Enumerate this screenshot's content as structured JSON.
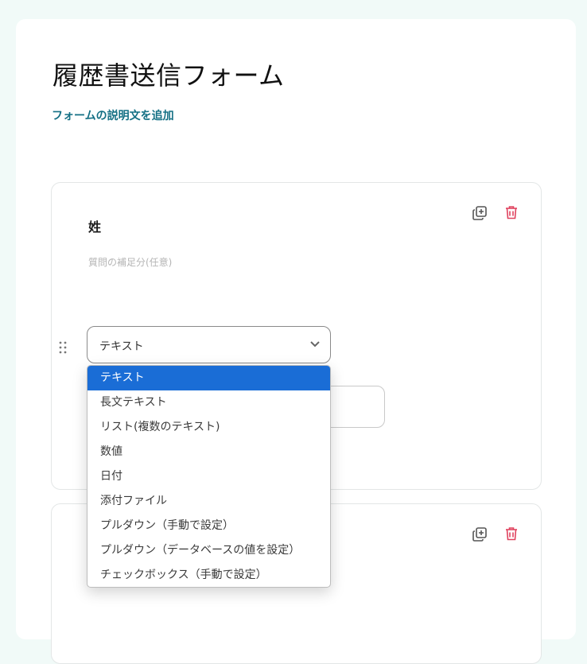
{
  "form": {
    "title": "履歴書送信フォーム",
    "add_description_link": "フォームの説明文を追加"
  },
  "question": {
    "title": "姓",
    "description_placeholder": "質問の補足分(任意)",
    "field_type_value": "テキスト"
  },
  "dropdown": {
    "options": [
      "テキスト",
      "長文テキスト",
      "リスト(複数のテキスト)",
      "数値",
      "日付",
      "添付ファイル",
      "プルダウン（手動で設定）",
      "プルダウン（データベースの値を設定）",
      "チェックボックス（手動で設定）"
    ],
    "selected_index": 0
  },
  "colors": {
    "accent_link": "#136f84",
    "delete_icon": "#e0435f",
    "selected_option_bg": "#1a6dd6"
  },
  "icons": [
    "duplicate-icon",
    "trash-icon",
    "drag-handle-icon",
    "chevron-down-icon"
  ]
}
